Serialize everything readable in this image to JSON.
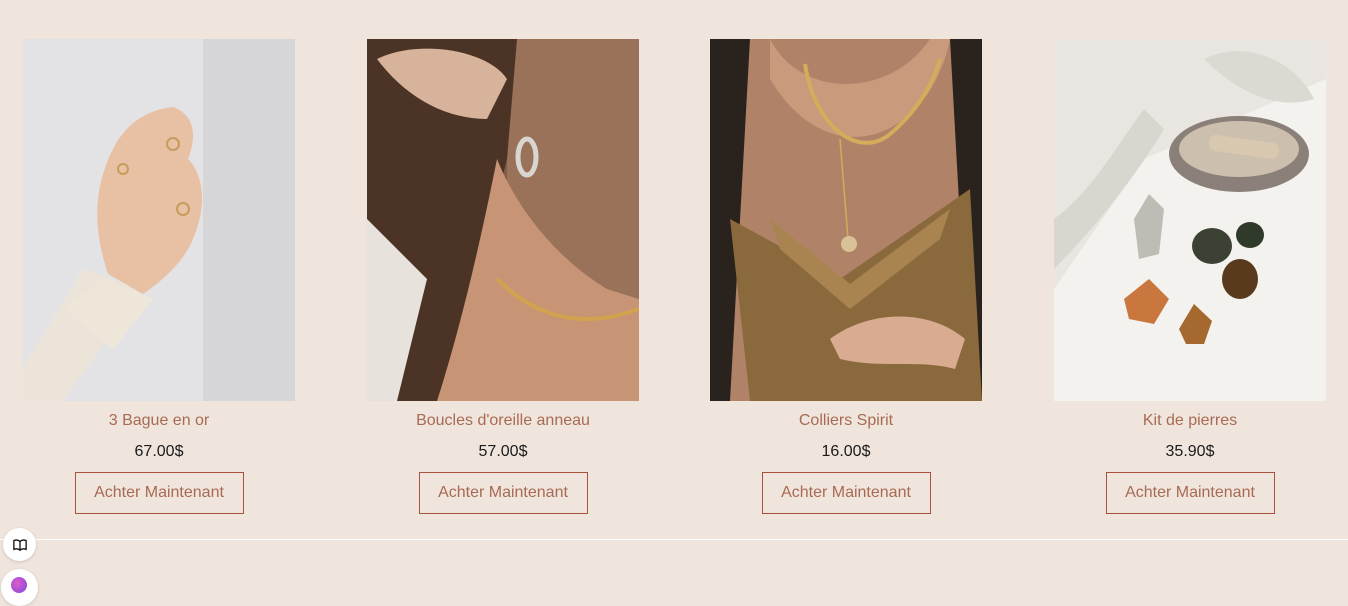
{
  "products": [
    {
      "name": "3 Bague en or",
      "price": "67.00$",
      "button": "Achter Maintenant",
      "image": "hand-with-gold-rings"
    },
    {
      "name": "Boucles d'oreille anneau",
      "price": "57.00$",
      "button": "Achter Maintenant",
      "image": "ear-with-hoop-earring"
    },
    {
      "name": "Colliers Spirit",
      "price": "16.00$",
      "button": "Achter Maintenant",
      "image": "gold-chain-necklace"
    },
    {
      "name": "Kit de pierres",
      "price": "35.90$",
      "button": "Achter Maintenant",
      "image": "stones-and-shell"
    }
  ],
  "floating": {
    "book_icon": "book-icon",
    "logo_icon": "accessibility-logo-icon"
  },
  "colors": {
    "background": "#f0e5dd",
    "name_text": "#a86a52",
    "price_text": "#1a1a1a",
    "button_border": "#a8523e"
  }
}
